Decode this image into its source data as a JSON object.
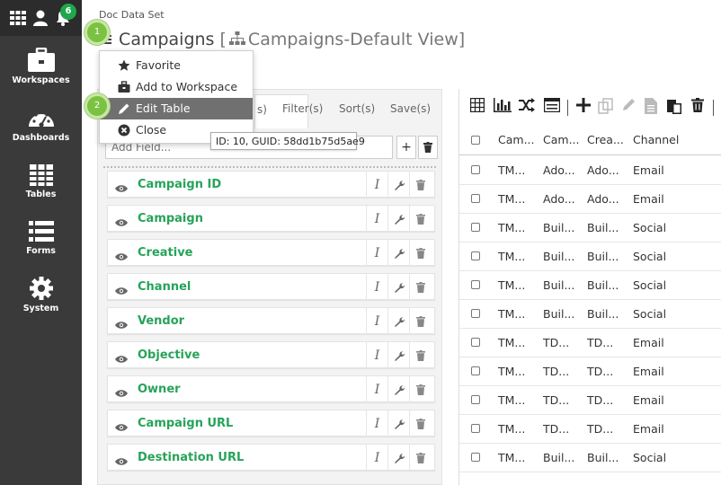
{
  "app": {
    "notification_count": "6"
  },
  "sidebar": {
    "items": [
      {
        "label": "Workspaces",
        "icon": "briefcase-icon"
      },
      {
        "label": "Dashboards",
        "icon": "dashboard-gauge-icon"
      },
      {
        "label": "Tables",
        "icon": "table-grid-icon"
      },
      {
        "label": "Forms",
        "icon": "form-list-icon"
      },
      {
        "label": "System",
        "icon": "gear-icon"
      }
    ]
  },
  "header": {
    "breadcrumb": "Doc Data Set",
    "title": "Campaigns",
    "bracket_open": "[",
    "view_name": "Campaigns-Default View]"
  },
  "menu": {
    "items": [
      {
        "label": "Favorite",
        "icon": "star-icon"
      },
      {
        "label": "Add to Workspace",
        "icon": "briefcase-icon"
      },
      {
        "label": "Edit Table",
        "icon": "pencil-icon"
      },
      {
        "label": "Close",
        "icon": "close-circle-icon"
      }
    ]
  },
  "steps": [
    "1",
    "2"
  ],
  "tooltip": "ID: 10, GUID: 58dd1b75d5ae9",
  "left_panel": {
    "tabs": [
      "s)",
      "Filter(s)",
      "Sort(s)",
      "Save(s)"
    ],
    "add_field_placeholder": "Add Field...",
    "add_button": "+",
    "fields": [
      "Campaign ID",
      "Campaign",
      "Creative",
      "Channel",
      "Vendor",
      "Objective",
      "Owner",
      "Campaign URL",
      "Destination URL"
    ],
    "field_action_italic": "I"
  },
  "table": {
    "columns": [
      "Cam...",
      "Cam...",
      "Crea...",
      "Channel"
    ],
    "rows": [
      [
        "TM...",
        "Ado...",
        "Ado...",
        "Email"
      ],
      [
        "TM...",
        "Ado...",
        "Ado...",
        "Email"
      ],
      [
        "TM...",
        "Buil...",
        "Buil...",
        "Social"
      ],
      [
        "TM...",
        "Buil...",
        "Buil...",
        "Social"
      ],
      [
        "TM...",
        "Buil...",
        "Buil...",
        "Social"
      ],
      [
        "TM...",
        "Buil...",
        "Buil...",
        "Social"
      ],
      [
        "TM...",
        "TD...",
        "TD...",
        "Email"
      ],
      [
        "TM...",
        "TD...",
        "TD...",
        "Email"
      ],
      [
        "TM...",
        "TD...",
        "TD...",
        "Email"
      ],
      [
        "TM...",
        "TD...",
        "TD...",
        "Email"
      ],
      [
        "TM...",
        "Buil...",
        "Buil...",
        "Social"
      ]
    ]
  },
  "colors": {
    "sidebar": "#3a3a3a",
    "accent_green": "#27a35a",
    "badge_green": "#1ea84b",
    "step_green": "#7cc242",
    "menu_active": "#707070"
  }
}
